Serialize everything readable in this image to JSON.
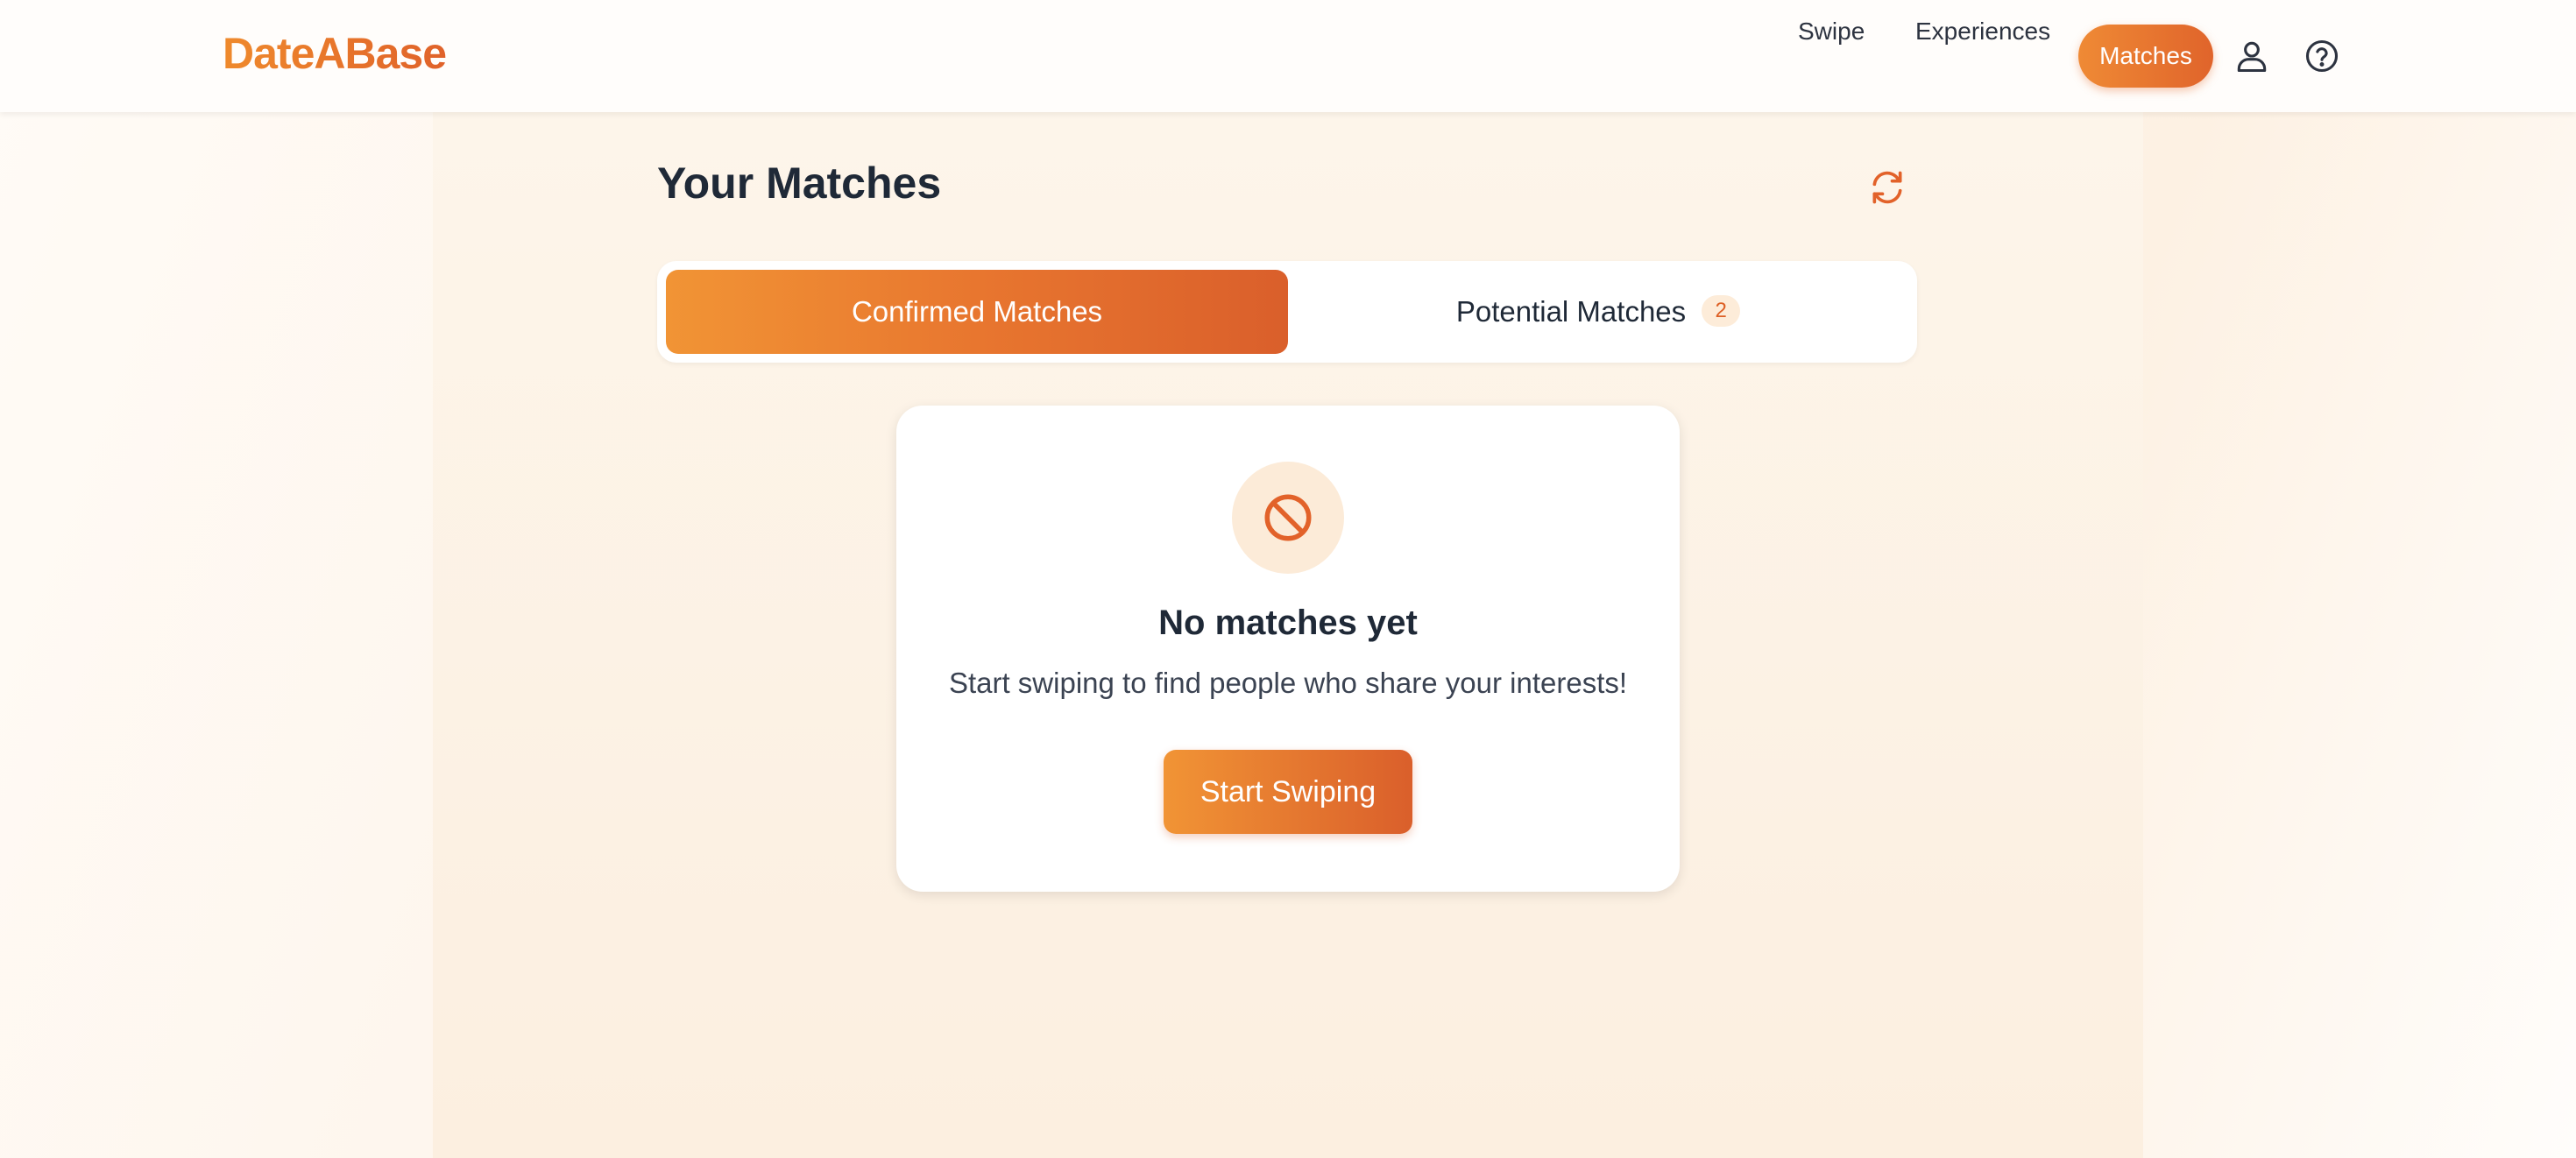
{
  "brand": {
    "name": "DateABase"
  },
  "nav": {
    "items": [
      "Swipe",
      "Experiences"
    ],
    "active": "Matches",
    "icons": [
      "user-icon",
      "help-circle-icon"
    ]
  },
  "page": {
    "title": "Your Matches",
    "refresh_icon": "refresh-icon"
  },
  "tabs": {
    "confirmed": "Confirmed Matches",
    "potential": "Potential Matches",
    "potential_count": "2"
  },
  "empty_state": {
    "icon": "no-entry-icon",
    "title": "No matches yet",
    "subtitle": "Start swiping to find people who share your interests!",
    "cta": "Start Swiping"
  },
  "colors": {
    "accent": "#e96e2a",
    "accent_light": "#f19435",
    "accent_dark": "#da5f2b",
    "badge_bg": "#fdecd9",
    "text": "#1f2937"
  }
}
